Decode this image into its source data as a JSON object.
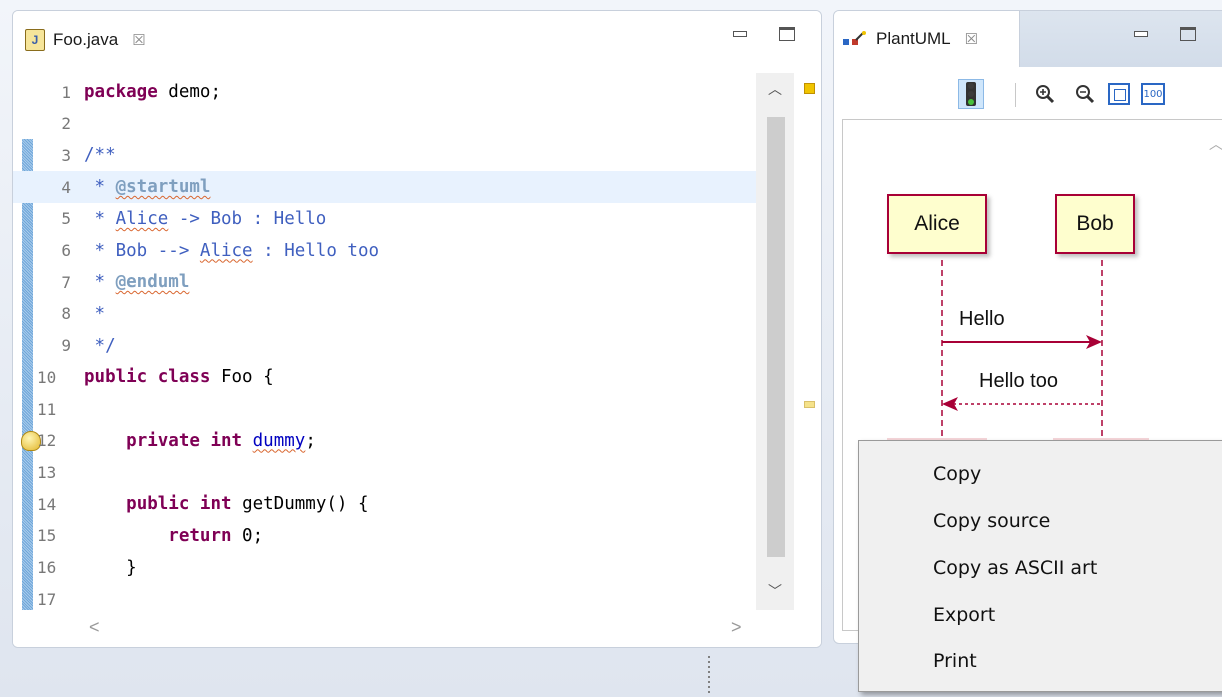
{
  "editor": {
    "tab_title": "Foo.java",
    "tab_icon": "java-file-icon",
    "lines": [
      {
        "num": "1",
        "parts": [
          {
            "t": "package",
            "c": "kw"
          },
          {
            "t": " demo;",
            "c": ""
          }
        ]
      },
      {
        "num": "2",
        "parts": []
      },
      {
        "num": "3",
        "parts": [
          {
            "t": "/**",
            "c": "cm"
          }
        ]
      },
      {
        "num": "4",
        "parts": [
          {
            "t": " * ",
            "c": "cm"
          },
          {
            "t": "@startuml",
            "c": "tag squig"
          }
        ],
        "highlight": true
      },
      {
        "num": "5",
        "parts": [
          {
            "t": " * ",
            "c": "cm"
          },
          {
            "t": "Alice",
            "c": "cm squig"
          },
          {
            "t": " -> Bob : Hello",
            "c": "cm"
          }
        ]
      },
      {
        "num": "6",
        "parts": [
          {
            "t": " * Bob --> ",
            "c": "cm"
          },
          {
            "t": "Alice",
            "c": "cm squig"
          },
          {
            "t": " : Hello too",
            "c": "cm"
          }
        ]
      },
      {
        "num": "7",
        "parts": [
          {
            "t": " * ",
            "c": "cm"
          },
          {
            "t": "@enduml",
            "c": "tag squig"
          }
        ]
      },
      {
        "num": "8",
        "parts": [
          {
            "t": " *",
            "c": "cm"
          }
        ]
      },
      {
        "num": "9",
        "parts": [
          {
            "t": " */",
            "c": "cm"
          }
        ]
      },
      {
        "num": "10",
        "parts": [
          {
            "t": "public",
            "c": "kw"
          },
          {
            "t": " ",
            "c": ""
          },
          {
            "t": "class",
            "c": "kw"
          },
          {
            "t": " Foo {",
            "c": ""
          }
        ]
      },
      {
        "num": "11",
        "parts": []
      },
      {
        "num": "12",
        "parts": [
          {
            "t": "    ",
            "c": ""
          },
          {
            "t": "private",
            "c": "kw"
          },
          {
            "t": " ",
            "c": ""
          },
          {
            "t": "int",
            "c": "kw"
          },
          {
            "t": " ",
            "c": ""
          },
          {
            "t": "dummy",
            "c": "fld squig"
          },
          {
            "t": ";",
            "c": ""
          }
        ],
        "warning": true
      },
      {
        "num": "13",
        "parts": []
      },
      {
        "num": "14",
        "parts": [
          {
            "t": "    ",
            "c": ""
          },
          {
            "t": "public",
            "c": "kw"
          },
          {
            "t": " ",
            "c": ""
          },
          {
            "t": "int",
            "c": "kw"
          },
          {
            "t": " getDummy() {",
            "c": ""
          }
        ]
      },
      {
        "num": "15",
        "parts": [
          {
            "t": "        ",
            "c": ""
          },
          {
            "t": "return",
            "c": "kw"
          },
          {
            "t": " 0;",
            "c": ""
          }
        ]
      },
      {
        "num": "16",
        "parts": [
          {
            "t": "    }",
            "c": ""
          }
        ]
      },
      {
        "num": "17",
        "parts": []
      }
    ],
    "annotation_colors": {
      "current": "#f0c400",
      "occurrence": "#f5e28a"
    }
  },
  "plantuml": {
    "tab_title": "PlantUML",
    "tab_icon": "plantuml-icon",
    "toolbar": [
      "traffic-light-icon",
      "zoom-in-icon",
      "zoom-out-icon",
      "fit-to-window-icon",
      "zoom-100-icon"
    ],
    "zoom_label": "100",
    "diagram": {
      "participants": [
        "Alice",
        "Bob"
      ],
      "messages": [
        {
          "from": "Alice",
          "to": "Bob",
          "label": "Hello",
          "style": "solid"
        },
        {
          "from": "Bob",
          "to": "Alice",
          "label": "Hello too",
          "style": "dashed"
        }
      ],
      "colors": {
        "participant_fill": "#fefece",
        "participant_border": "#a80036",
        "arrow": "#a80036"
      }
    }
  },
  "context_menu": {
    "items": [
      "Copy",
      "Copy source",
      "Copy as ASCII art",
      "Export",
      "Print"
    ]
  }
}
